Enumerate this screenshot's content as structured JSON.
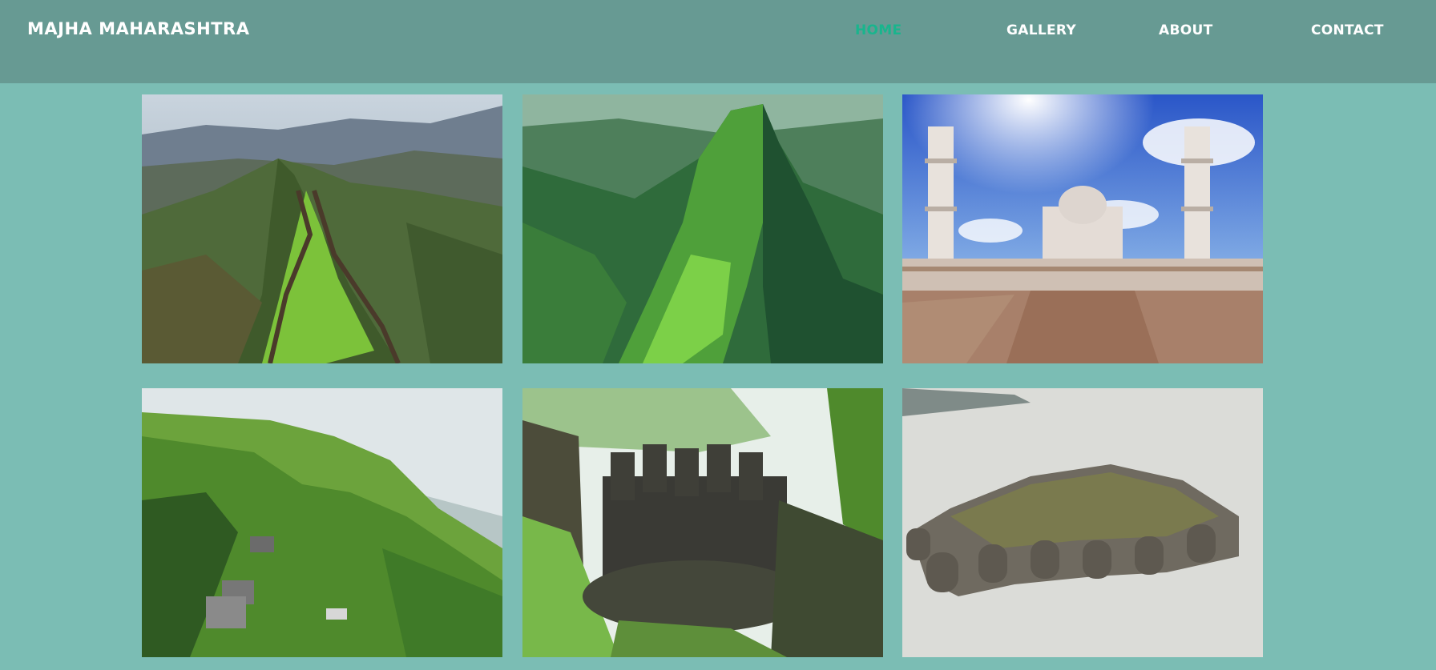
{
  "header": {
    "brand": "MAJHA MAHARASHTRA",
    "nav": [
      {
        "label": "HOME",
        "active": true
      },
      {
        "label": "GALLERY",
        "active": false
      },
      {
        "label": "ABOUT",
        "active": false
      },
      {
        "label": "CONTACT",
        "active": false
      }
    ]
  },
  "colors": {
    "header_bg": "#679a93",
    "page_bg": "#7bbdb4",
    "nav_active": "#19b58d",
    "nav_text": "#ffffff"
  },
  "gallery": {
    "images": [
      {
        "subject": "ridge-fort-photo"
      },
      {
        "subject": "green-cliff-photo"
      },
      {
        "subject": "mausoleum-photo"
      },
      {
        "subject": "hill-fort-photo"
      },
      {
        "subject": "bastion-ruins-photo"
      },
      {
        "subject": "sea-fort-photo"
      }
    ]
  }
}
